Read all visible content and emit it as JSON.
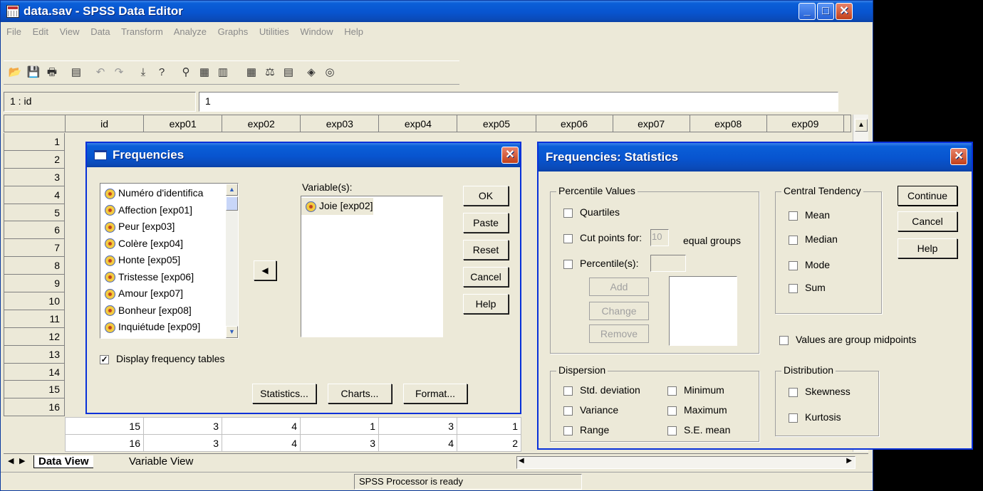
{
  "main_window": {
    "title": "data.sav - SPSS Data Editor",
    "menu": [
      "File",
      "Edit",
      "View",
      "Data",
      "Transform",
      "Analyze",
      "Graphs",
      "Utilities",
      "Window",
      "Help"
    ],
    "cell_ref": "1 : id",
    "cell_value": "1",
    "columns": [
      "id",
      "exp01",
      "exp02",
      "exp03",
      "exp04",
      "exp05",
      "exp06",
      "exp07",
      "exp08",
      "exp09"
    ],
    "row_numbers": [
      "1",
      "2",
      "3",
      "4",
      "5",
      "6",
      "7",
      "8",
      "9",
      "10",
      "11",
      "12",
      "13",
      "14",
      "15",
      "16"
    ],
    "visible_rows": [
      {
        "row": "15",
        "values": [
          "15",
          "3",
          "4",
          "1",
          "3",
          "1"
        ]
      },
      {
        "row": "16",
        "values": [
          "16",
          "3",
          "4",
          "3",
          "4",
          "2"
        ]
      }
    ],
    "tabs": [
      "Data View",
      "Variable View"
    ],
    "status": "SPSS Processor  is ready",
    "toolbar_icons": [
      "open-icon",
      "save-icon",
      "print-icon",
      "dialog-recall-icon",
      "undo-icon",
      "redo-icon",
      "goto-case-icon",
      "variables-icon",
      "find-icon",
      "insert-case-icon",
      "insert-variable-icon",
      "split-file-icon",
      "weight-cases-icon",
      "select-cases-icon",
      "value-labels-icon",
      "use-sets-icon"
    ]
  },
  "frequencies_dialog": {
    "title": "Frequencies",
    "source_variables": [
      "Numéro d'identifica",
      "Affection [exp01]",
      "Peur [exp03]",
      "Colère [exp04]",
      "Honte [exp05]",
      "Tristesse [exp06]",
      "Amour [exp07]",
      "Bonheur [exp08]",
      "Inquiétude [exp09]"
    ],
    "target_label": "Variable(s):",
    "target_variables": [
      "Joie [exp02]"
    ],
    "buttons": [
      "OK",
      "Paste",
      "Reset",
      "Cancel",
      "Help"
    ],
    "display_tables_label": "Display frequency tables",
    "display_tables_checked": true,
    "bottom_buttons": [
      "Statistics...",
      "Charts...",
      "Format..."
    ]
  },
  "statistics_dialog": {
    "title": "Frequencies: Statistics",
    "percentile_group": "Percentile Values",
    "quartiles": "Quartiles",
    "cut_points": "Cut points for:",
    "cut_points_value": "10",
    "equal_groups": "equal groups",
    "percentiles": "Percentile(s):",
    "add": "Add",
    "change": "Change",
    "remove": "Remove",
    "central_group": "Central Tendency",
    "central": [
      "Mean",
      "Median",
      "Mode",
      "Sum"
    ],
    "buttons": [
      "Continue",
      "Cancel",
      "Help"
    ],
    "midpoints": "Values are group midpoints",
    "dispersion_group": "Dispersion",
    "dispersion_left": [
      "Std. deviation",
      "Variance",
      "Range"
    ],
    "dispersion_right": [
      "Minimum",
      "Maximum",
      "S.E. mean"
    ],
    "distribution_group": "Distribution",
    "distribution": [
      "Skewness",
      "Kurtosis"
    ]
  }
}
